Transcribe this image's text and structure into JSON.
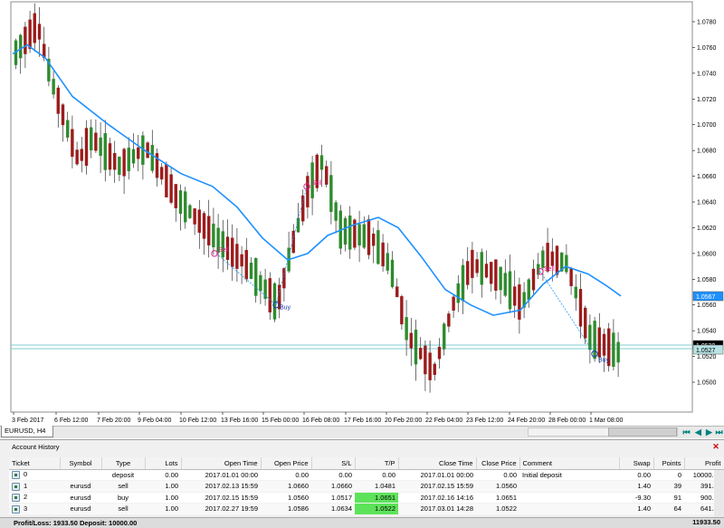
{
  "chart": {
    "symbol_tab": "EURUSD, H4",
    "price_labels": [
      "1.0780",
      "1.0760",
      "1.0740",
      "1.0720",
      "1.0700",
      "1.0680",
      "1.0660",
      "1.0640",
      "1.0620",
      "1.0600",
      "1.0580",
      "1.0560",
      "1.0540",
      "1.0520",
      "1.0500"
    ],
    "time_labels": [
      "3 Feb 2017",
      "6 Feb 12:00",
      "7 Feb 20:00",
      "9 Feb 04:00",
      "10 Feb 12:00",
      "13 Feb 16:00",
      "15 Feb 00:00",
      "16 Feb 08:00",
      "17 Feb 16:00",
      "20 Feb 20:00",
      "22 Feb 04:00",
      "23 Feb 12:00",
      "24 Feb 20:00",
      "28 Feb 00:00",
      "1 Mar 08:00"
    ],
    "ma_price_tag": "1.0567",
    "bid_price_tag": "1.0530",
    "bid_price_tag_2": "1.0527",
    "trade_marks": [
      {
        "label": "Sell",
        "color": "#e0208a"
      },
      {
        "label": "Buy",
        "color": "#1b3fa8"
      },
      {
        "label": "Sell",
        "color": "#e0208a"
      },
      {
        "label": "Sell",
        "color": "#e0208a"
      },
      {
        "label": "Buy",
        "color": "#1b3fa8"
      }
    ],
    "colors": {
      "bull": "#2e8b2e",
      "bear": "#9b1c1c",
      "ma": "#1e90ff",
      "bid": "#7fcfd2",
      "trade_line": "#2196f3"
    }
  },
  "panel": {
    "title": "Account History",
    "columns": [
      "Ticket",
      "Symbol",
      "Type",
      "Lots",
      "Open Time",
      "Open Price",
      "S/L",
      "T/P",
      "Close Time",
      "Close Price",
      "Comment",
      "Swap",
      "Points",
      "Profit"
    ],
    "rows": [
      {
        "ticket": "0",
        "symbol": "",
        "type": "deposit",
        "lots": "0.00",
        "open_time": "2017.01.01 00:00",
        "open_price": "0.00",
        "sl": "0.00",
        "tp": "0.00",
        "close_time": "2017.01.01 00:00",
        "close_price": "0.00",
        "comment": "Initial deposit",
        "swap": "0.00",
        "points": "0",
        "profit": "10000.00"
      },
      {
        "ticket": "1",
        "symbol": "eurusd",
        "type": "sell",
        "lots": "1.00",
        "open_time": "2017.02.13 15:59",
        "open_price": "1.0660",
        "sl": "1.0660",
        "tp": "1.0481",
        "close_time": "2017.02.15 15:59",
        "close_price": "1.0560",
        "comment": "",
        "swap": "1.40",
        "points": "39",
        "profit": "391.40"
      },
      {
        "ticket": "2",
        "symbol": "eurusd",
        "type": "buy",
        "lots": "1.00",
        "open_time": "2017.02.15 15:59",
        "open_price": "1.0560",
        "sl": "1.0517",
        "tp": "1.0651",
        "close_time": "2017.02.16 14:16",
        "close_price": "1.0651",
        "comment": "",
        "swap": "-9.30",
        "points": "91",
        "profit": "900.70"
      },
      {
        "ticket": "3",
        "symbol": "eurusd",
        "type": "sell",
        "lots": "1.00",
        "open_time": "2017.02.27 19:59",
        "open_price": "1.0586",
        "sl": "1.0634",
        "tp": "1.0522",
        "close_time": "2017.03.01 14:28",
        "close_price": "1.0522",
        "comment": "",
        "swap": "1.40",
        "points": "64",
        "profit": "641.40"
      }
    ],
    "summary": "Profit/Loss: 1933.50 Deposit: 10000.00",
    "summary_total": "11933.50"
  }
}
